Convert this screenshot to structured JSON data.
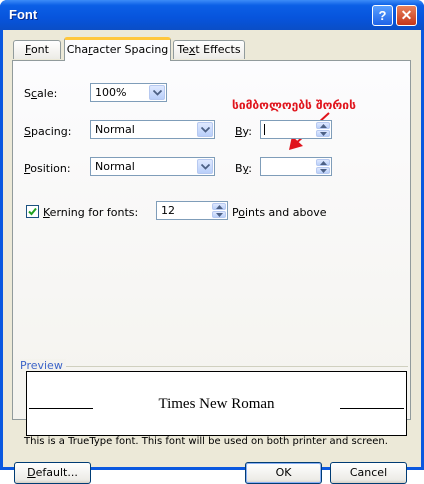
{
  "window": {
    "title": "Font",
    "help_label": "?",
    "close_label": "✕"
  },
  "tabs": [
    {
      "label": "Font",
      "mnemonic": "F",
      "rest": "ont",
      "active": false
    },
    {
      "label": "Character Spacing",
      "pre": "Cha",
      "mnemonic": "r",
      "rest": "acter Spacing",
      "active": true
    },
    {
      "label": "Text Effects",
      "pre": "Te",
      "mnemonic": "x",
      "rest": "t Effects",
      "active": false
    }
  ],
  "fields": {
    "scale": {
      "pre": "S",
      "mnemonic": "c",
      "rest": "ale:",
      "value": "100%"
    },
    "spacing": {
      "mnemonic": "S",
      "rest": "pacing:",
      "value": "Normal",
      "by_pre": "",
      "by_mnemonic": "B",
      "by_rest": "y:",
      "by_value": ""
    },
    "position": {
      "mnemonic": "P",
      "rest": "osition:",
      "value": "Normal",
      "by_pre": "B",
      "by_mnemonic": "y",
      "by_rest": ":",
      "by_value": ""
    },
    "kerning": {
      "checked": true,
      "mnemonic": "K",
      "rest": "erning for fonts:",
      "value": "12",
      "suffix_pre": "P",
      "suffix_mnemonic": "o",
      "suffix_rest": "ints and above"
    }
  },
  "annotation": {
    "text": "სიმბოლოებს შორის",
    "color": "#e0141c"
  },
  "preview": {
    "label": "Preview",
    "sample": "Times New Roman",
    "info": "This is a TrueType font. This font will be used on both printer and screen."
  },
  "buttons": {
    "default_mnemonic": "D",
    "default_rest": "efault...",
    "ok": "OK",
    "cancel": "Cancel"
  },
  "colors": {
    "title_blue": "#0754dc",
    "face": "#ece9d8",
    "accent_tab": "#ffc73c"
  }
}
